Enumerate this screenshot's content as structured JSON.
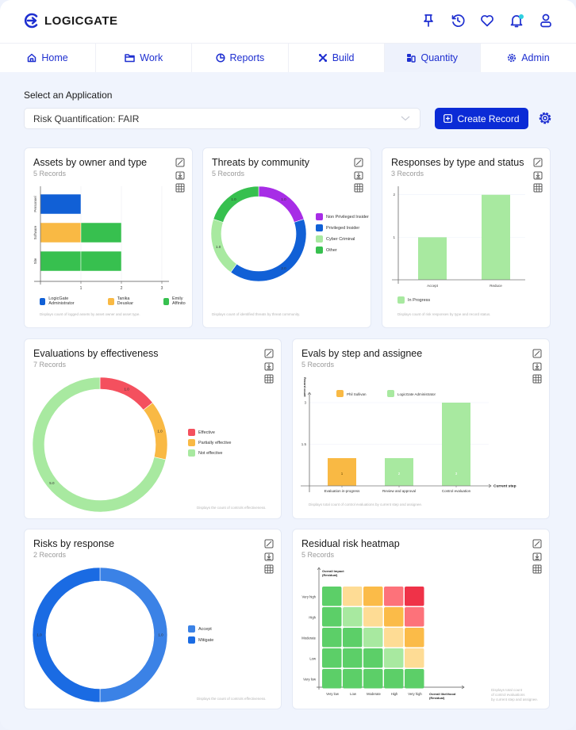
{
  "header": {
    "brand": "LOGICGATE",
    "icons": [
      "pin-icon",
      "history-icon",
      "heart-icon",
      "bell-icon",
      "user-icon"
    ],
    "accent": "#1e2fd0",
    "notification_dot_color": "#2fd0e0"
  },
  "nav": {
    "tabs": [
      {
        "label": "Home",
        "icon": "home-icon",
        "active": false
      },
      {
        "label": "Work",
        "icon": "folder-icon",
        "active": false
      },
      {
        "label": "Reports",
        "icon": "pie-chart-icon",
        "active": false
      },
      {
        "label": "Build",
        "icon": "tools-icon",
        "active": false
      },
      {
        "label": "Quantity",
        "icon": "coins-icon",
        "active": true
      },
      {
        "label": "Admin",
        "icon": "gear-icon",
        "active": false
      }
    ]
  },
  "app_select": {
    "label": "Select an Application",
    "value": "Risk Quantification: FAIR"
  },
  "toolbar": {
    "create_label": "Create Record",
    "create_color": "#0b2bd6"
  },
  "cards": {
    "assets": {
      "title": "Assets by owner and type",
      "records": "5 Records",
      "footnote": "Displays count of logged assets by asset owner and asset type."
    },
    "threats": {
      "title": "Threats by community",
      "records": "5 Records",
      "footnote": "Displays count of identified threats by threat community."
    },
    "responses": {
      "title": "Responses by type and status",
      "records": "3 Records",
      "footnote": "Displays count of risk responses by type and record status."
    },
    "evaluations": {
      "title": "Evaluations by effectiveness",
      "records": "7 Records",
      "footnote": "Displays the count of controls effectiveness."
    },
    "evals_step": {
      "title": "Evals by step and assignee",
      "records": "5 Records",
      "footnote": "Displays total count of control evaluations by current step and assignee."
    },
    "risks": {
      "title": "Risks by response",
      "records": "2 Records",
      "footnote": "Displays the count of controls effectiveness."
    },
    "heatmap": {
      "title": "Residual risk heatmap",
      "records": "5 Records",
      "footnote_lines": [
        "Displays total count",
        "of control evaluations",
        "by current step and assignee."
      ]
    }
  },
  "chart_data": [
    {
      "id": "assets",
      "type": "bar",
      "orientation": "horizontal",
      "stacked": true,
      "categories": [
        "Personnel",
        "Software",
        "Site"
      ],
      "series": [
        {
          "name": "LogicGate Administrator",
          "color": "#1160d6",
          "values": [
            1,
            0,
            0
          ]
        },
        {
          "name": "Tanika Deuskar",
          "color": "#f9b944",
          "values": [
            0,
            1,
            0
          ]
        },
        {
          "name": "Emily Affinito",
          "color": "#37c04f",
          "values": [
            0,
            1,
            2
          ]
        }
      ],
      "xticks": [
        "1",
        "2",
        "3"
      ],
      "xlim": [
        0,
        3
      ],
      "legend": "bottom"
    },
    {
      "id": "threats",
      "type": "pie",
      "donut": true,
      "slices": [
        {
          "label": "Non Privileged Insider",
          "value": 1,
          "display": "1.0",
          "color": "#a72de6"
        },
        {
          "label": "Privileged Insider",
          "value": 2,
          "display": "2.0",
          "color": "#1160d6"
        },
        {
          "label": "Cyber Criminal",
          "value": 1,
          "display": "1.0",
          "color": "#a8e9a0"
        },
        {
          "label": "Other",
          "value": 1,
          "display": "1.0",
          "color": "#37c04f"
        }
      ],
      "legend": "right"
    },
    {
      "id": "responses",
      "type": "bar",
      "categories": [
        "Accept",
        "Reduce"
      ],
      "series": [
        {
          "name": "In Progress",
          "color": "#a8e9a0",
          "values": [
            1,
            2
          ]
        }
      ],
      "yticks": [
        "1",
        "2"
      ],
      "ylim": [
        0,
        2.2
      ],
      "legend": "bottom"
    },
    {
      "id": "evaluations",
      "type": "pie",
      "donut": true,
      "slices": [
        {
          "label": "Effective",
          "value": 1,
          "display": "1.0",
          "color": "#f4505e"
        },
        {
          "label": "Partially effective",
          "value": 1,
          "display": "1.0",
          "color": "#f9b944"
        },
        {
          "label": "Not effective",
          "value": 5,
          "display": "5.0",
          "color": "#a8e9a0"
        }
      ],
      "legend": "right"
    },
    {
      "id": "evals_step",
      "type": "bar",
      "categories": [
        "Evaluation in-progress",
        "Review and approval",
        "Control evaluation"
      ],
      "series": [
        {
          "name": "Phil Sullivan",
          "color": "#f9b944",
          "values": [
            1,
            0,
            0
          ]
        },
        {
          "name": "LogicGate Administrator",
          "color": "#a8e9a0",
          "values": [
            0,
            1,
            3
          ]
        }
      ],
      "bar_labels": [
        "1",
        "2",
        "3"
      ],
      "yticks": [
        "1.5",
        "3"
      ],
      "ylim": [
        0,
        3
      ],
      "xlabel": "Current step",
      "ylabel": "Record count",
      "legend": "top"
    },
    {
      "id": "risks",
      "type": "pie",
      "donut": true,
      "slices": [
        {
          "label": "Accept",
          "value": 1,
          "display": "1.0",
          "color": "#3b82e6"
        },
        {
          "label": "Mitigate",
          "value": 1,
          "display": "1.0",
          "color": "#1a6be3"
        }
      ],
      "legend": "right"
    },
    {
      "id": "heatmap",
      "type": "heatmap",
      "xlabel": "Overall likelihood (Residual)",
      "ylabel": "Overall Impact (Residual)",
      "x": [
        "Very low",
        "Low",
        "Moderate",
        "High",
        "Very high"
      ],
      "y": [
        "Very high",
        "High",
        "Moderate",
        "Low",
        "Very low"
      ],
      "levels": [
        [
          "green",
          "light-yellow",
          "orange",
          "pink",
          "red"
        ],
        [
          "green",
          "light-green",
          "light-yellow",
          "orange",
          "pink"
        ],
        [
          "green",
          "green",
          "light-green",
          "light-yellow",
          "orange"
        ],
        [
          "green",
          "green",
          "green",
          "light-green",
          "light-yellow"
        ],
        [
          "green",
          "green",
          "green",
          "green",
          "green"
        ]
      ],
      "palette": {
        "green": "#5ccf68",
        "light-green": "#a8e9a0",
        "light-yellow": "#fedc95",
        "orange": "#fbbb48",
        "pink": "#fd727a",
        "red": "#ef3248"
      }
    }
  ]
}
